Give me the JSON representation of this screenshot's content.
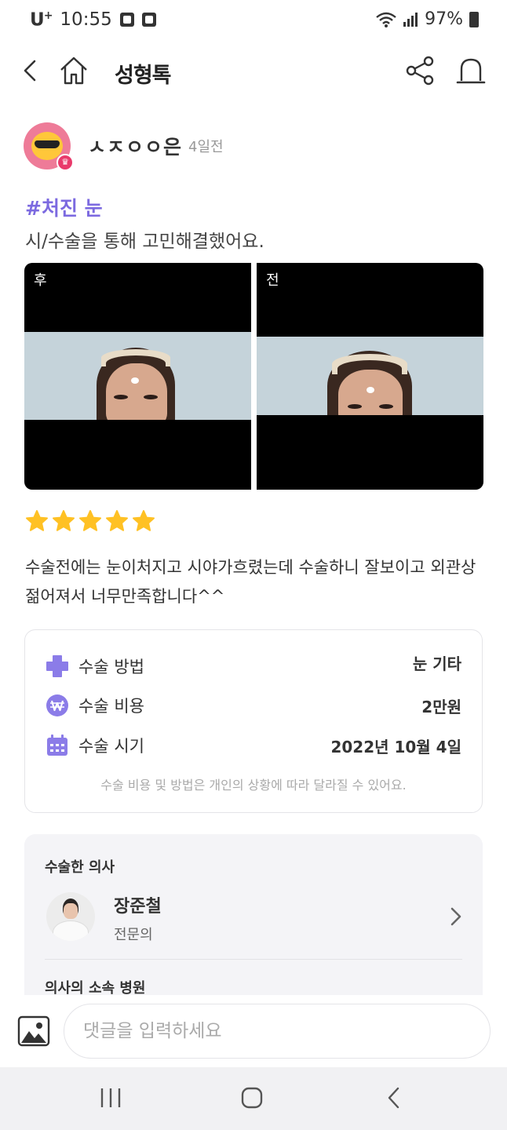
{
  "status_bar": {
    "carrier": "U",
    "carrier_sup": "+",
    "time": "10:55",
    "battery": "97%"
  },
  "topbar": {
    "title": "성형톡"
  },
  "post": {
    "author": "ㅅㅈㅇㅇ은",
    "posted_ago": "4일전",
    "hashtag": "#처진 눈",
    "subtitle": "시/수술을 통해 고민해결했어요.",
    "photos": [
      {
        "label": "후"
      },
      {
        "label": "전"
      }
    ],
    "rating": 5,
    "review": "수술전에는 눈이처지고  시야가흐렸는데 수술하니 잘보이고 외관상 젊어져서 너무만족합니다^^"
  },
  "info": {
    "method_label": "수술 방법",
    "method_value": "눈 기타",
    "cost_label": "수술 비용",
    "cost_value": "2만원",
    "date_label": "수술 시기",
    "date_value": "2022년 10월 4일",
    "note": "수술 비용 및 방법은 개인의 상황에 따라 달라질 수 있어요."
  },
  "doctor": {
    "heading": "수술한 의사",
    "name": "장준철",
    "role": "전문의",
    "hospital_heading": "의사의 소속 병원"
  },
  "comment": {
    "placeholder": "댓글을 입력하세요"
  },
  "colors": {
    "accent": "#7c6ae0",
    "star": "#ffc124"
  }
}
